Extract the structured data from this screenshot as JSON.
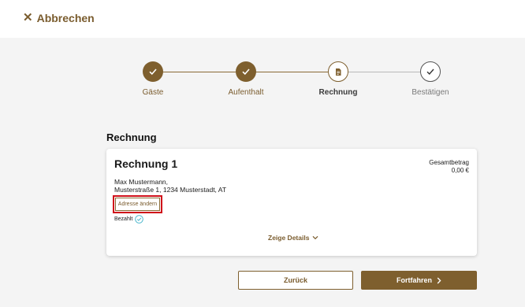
{
  "header": {
    "cancel_label": "Abbrechen",
    "cancel_icon": "close-icon"
  },
  "stepper": {
    "steps": [
      {
        "label": "Gäste",
        "state": "done",
        "icon": "check-icon"
      },
      {
        "label": "Aufenthalt",
        "state": "done",
        "icon": "check-icon"
      },
      {
        "label": "Rechnung",
        "state": "current",
        "icon": "document-icon"
      },
      {
        "label": "Bestätigen",
        "state": "todo",
        "icon": "check-icon"
      }
    ]
  },
  "section": {
    "title": "Rechnung"
  },
  "invoice": {
    "title": "Rechnung 1",
    "total_label": "Gesamtbetrag",
    "total_value": "0,00 €",
    "name": "Max Mustermann,",
    "street": "Musterstraße 1, 1234 Musterstadt, AT",
    "change_address_label": "Adresse ändern",
    "paid_label": "Bezahlt",
    "details_label": "Zeige Details"
  },
  "footer": {
    "back_label": "Zurück",
    "next_label": "Fortfahren"
  },
  "colors": {
    "accent": "#7e5f2e",
    "highlight": "#d0101a",
    "paid_check": "#3ab0c8"
  }
}
